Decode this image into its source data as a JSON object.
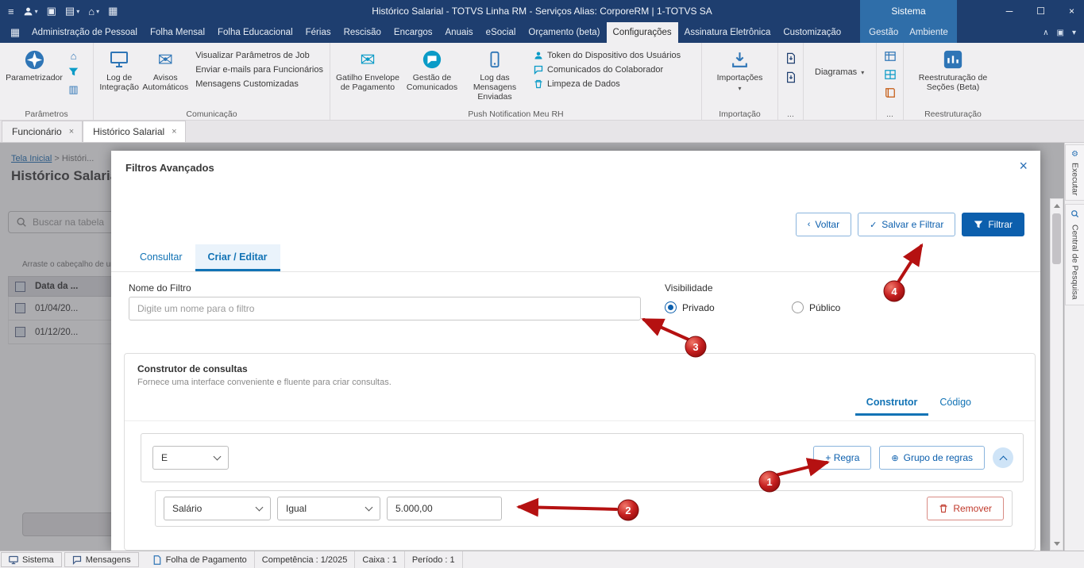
{
  "titlebar": {
    "title": "Histórico Salarial - TOTVS Linha RM - Serviços  Alias: CorporeRM | 1-TOTVS SA",
    "sistema": "Sistema"
  },
  "menubar": {
    "items": [
      "Administração de Pessoal",
      "Folha Mensal",
      "Folha Educacional",
      "Férias",
      "Rescisão",
      "Encargos",
      "Anuais",
      "eSocial",
      "Orçamento (beta)",
      "Configurações",
      "Assinatura Eletrônica",
      "Customização",
      "Gestão",
      "Ambiente"
    ],
    "active": "Configurações"
  },
  "ribbon": {
    "parametrizador": "Parametrizador",
    "group_parametros": "Parâmetros",
    "log_integracao": "Log de Integração",
    "avisos_automaticos": "Avisos Automáticos",
    "visualizar_job": "Visualizar Parâmetros de Job",
    "enviar_emails": "Enviar e-mails para Funcionários",
    "mensagens_customizadas": "Mensagens Customizadas",
    "group_comunicacao": "Comunicação",
    "gatilho_envelope": "Gatilho Envelope de Pagamento",
    "gestao_comunicados": "Gestão de Comunicados",
    "log_mensagens": "Log das Mensagens Enviadas",
    "token_dispositivo": "Token do Dispositivo dos Usuários",
    "comunicados_colaborador": "Comunicados do Colaborador",
    "limpeza_dados": "Limpeza de Dados",
    "group_push": "Push Notification Meu RH",
    "importacoes": "Importações",
    "group_importacao": "Importação",
    "group_dots1": "...",
    "diagramas": "Diagramas",
    "group_dots2": "...",
    "reestruturacao": "Reestruturação de Seções (Beta)",
    "group_reestruturacao": "Reestruturação"
  },
  "doc_tabs": {
    "funcionario": "Funcionário",
    "historico": "Histórico Salarial",
    "close": "×"
  },
  "background": {
    "breadcrumb_home": "Tela Inicial",
    "breadcrumb_sep": ">",
    "breadcrumb_current": "Históri...",
    "title": "Histórico Salarial",
    "search_placeholder": "Buscar na tabela",
    "drag_hint": "Arraste o cabeçalho de um...",
    "col_header": "Data da ...",
    "rows": [
      "01/04/20...",
      "01/12/20..."
    ]
  },
  "modal": {
    "title": "Filtros Avançados",
    "close": "×",
    "voltar": "Voltar",
    "salvar_filtrar": "Salvar e Filtrar",
    "filtrar": "Filtrar",
    "tab_consultar": "Consultar",
    "tab_criar": "Criar / Editar",
    "nome_label": "Nome do Filtro",
    "nome_placeholder": "Digite um nome para o filtro",
    "visibilidade": "Visibilidade",
    "privado": "Privado",
    "publico": "Público",
    "builder": {
      "title": "Construtor de consultas",
      "subtitle": "Fornece uma interface conveniente e fluente para criar consultas.",
      "tab_construtor": "Construtor",
      "tab_codigo": "Código",
      "combinator": "E",
      "add_rule": "+ Regra",
      "add_group": "Grupo de regras",
      "field": "Salário",
      "operator": "Igual",
      "value": "5.000,00",
      "remove": "Remover"
    }
  },
  "statusbar": {
    "sistema": "Sistema",
    "mensagens": "Mensagens",
    "folha": "Folha de Pagamento",
    "competencia": "Competência : 1/2025",
    "caixa": "Caixa : 1",
    "periodo": "Período : 1"
  },
  "sidepanel": {
    "executar": "Executar",
    "central": "Central de Pesquisa"
  },
  "annotations": {
    "n1": "1",
    "n2": "2",
    "n3": "3",
    "n4": "4"
  },
  "icons": {
    "menu": "≡",
    "caret": "▾",
    "home": "⌂",
    "copy": "▥",
    "envelope": "✉",
    "gear": "⚙",
    "plus_circle": "⊕",
    "check": "✓",
    "chevron_left": "‹",
    "minimize": "─",
    "maximize": "☐",
    "close": "×",
    "screenshot": "▣",
    "archive": "▤",
    "panels": "▦",
    "chevron_up": "∧"
  },
  "colors": {
    "titlebar": "#1e3e6f",
    "highlight": "#2f6ea9",
    "primary": "#0c5fad",
    "accent": "#0a9bc7",
    "annotation": "#b51111",
    "tab_active": "#1273b5"
  }
}
